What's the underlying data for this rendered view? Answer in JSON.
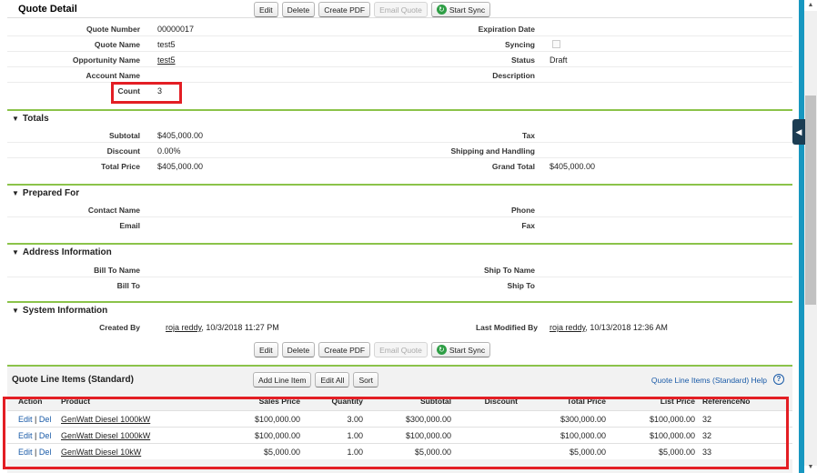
{
  "header": {
    "title": "Quote Detail",
    "buttons": {
      "edit": "Edit",
      "delete": "Delete",
      "create_pdf": "Create PDF",
      "email_quote": "Email Quote",
      "start_sync": "Start Sync"
    }
  },
  "quote": {
    "quote_number_label": "Quote Number",
    "quote_number": "00000017",
    "quote_name_label": "Quote Name",
    "quote_name": "test5",
    "opportunity_name_label": "Opportunity Name",
    "opportunity_name": "test5",
    "account_name_label": "Account Name",
    "account_name": "",
    "count_label": "Count",
    "count": "3",
    "expiration_date_label": "Expiration Date",
    "expiration_date": "",
    "syncing_label": "Syncing",
    "status_label": "Status",
    "status": "Draft",
    "description_label": "Description",
    "description": ""
  },
  "totals": {
    "title": "Totals",
    "subtotal_label": "Subtotal",
    "subtotal": "$405,000.00",
    "discount_label": "Discount",
    "discount": "0.00%",
    "total_price_label": "Total Price",
    "total_price": "$405,000.00",
    "tax_label": "Tax",
    "tax": "",
    "shipping_label": "Shipping and Handling",
    "shipping": "",
    "grand_total_label": "Grand Total",
    "grand_total": "$405,000.00"
  },
  "prepared_for": {
    "title": "Prepared For",
    "contact_name_label": "Contact Name",
    "email_label": "Email",
    "phone_label": "Phone",
    "fax_label": "Fax"
  },
  "address": {
    "title": "Address Information",
    "bill_to_name_label": "Bill To Name",
    "bill_to_label": "Bill To",
    "ship_to_name_label": "Ship To Name",
    "ship_to_label": "Ship To"
  },
  "system": {
    "title": "System Information",
    "created_by_label": "Created By",
    "created_by_user": "roja reddy",
    "created_by_date": ", 10/3/2018 11:27 PM",
    "last_modified_label": "Last Modified By",
    "last_modified_user": "roja reddy",
    "last_modified_date": ", 10/13/2018 12:36 AM"
  },
  "line_items": {
    "title": "Quote Line Items (Standard)",
    "buttons": {
      "add": "Add Line Item",
      "edit_all": "Edit All",
      "sort": "Sort"
    },
    "help_text": "Quote Line Items (Standard) Help",
    "help_icon": "?",
    "columns": [
      "Action",
      "Product",
      "Sales Price",
      "Quantity",
      "Subtotal",
      "Discount",
      "Total Price",
      "List Price",
      "ReferenceNo"
    ],
    "action_edit": "Edit",
    "action_sep": " | ",
    "action_del": "Del",
    "rows": [
      {
        "product": "GenWatt Diesel 1000kW",
        "sales_price": "$100,000.00",
        "quantity": "3.00",
        "subtotal": "$300,000.00",
        "discount": "",
        "total_price": "$300,000.00",
        "list_price": "$100,000.00",
        "reference_no": "32"
      },
      {
        "product": "GenWatt Diesel 1000kW",
        "sales_price": "$100,000.00",
        "quantity": "1.00",
        "subtotal": "$100,000.00",
        "discount": "",
        "total_price": "$100,000.00",
        "list_price": "$100,000.00",
        "reference_no": "32"
      },
      {
        "product": "GenWatt Diesel 10kW",
        "sales_price": "$5,000.00",
        "quantity": "1.00",
        "subtotal": "$5,000.00",
        "discount": "",
        "total_price": "$5,000.00",
        "list_price": "$5,000.00",
        "reference_no": "33"
      }
    ]
  },
  "icons": {
    "sync": "refresh-icon",
    "collapse": "collapse-arrow-icon",
    "section_toggle": "triangle-down-icon"
  },
  "colors": {
    "section_border": "#8bc34a",
    "highlight": "#e31e24",
    "link": "#1a5ba8",
    "sidebar": "#1797c0"
  }
}
